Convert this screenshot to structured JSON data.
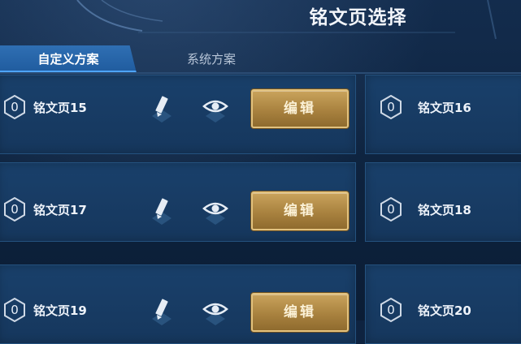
{
  "header": {
    "title": "铭文页选择"
  },
  "tabs": [
    {
      "label": "自定义方案",
      "active": true
    },
    {
      "label": "系统方案",
      "active": false
    }
  ],
  "rows": [
    {
      "left": {
        "count": "0",
        "name": "铭文页15",
        "edit_label": "编辑"
      },
      "right": {
        "count": "0",
        "name": "铭文页16"
      }
    },
    {
      "left": {
        "count": "0",
        "name": "铭文页17",
        "edit_label": "编辑"
      },
      "right": {
        "count": "0",
        "name": "铭文页18"
      }
    },
    {
      "left": {
        "count": "0",
        "name": "铭文页19",
        "edit_label": "编辑"
      },
      "right": {
        "count": "0",
        "name": "铭文页20"
      }
    }
  ],
  "icons": {
    "rename": "pencil-icon",
    "preview": "eye-icon",
    "level": "hexagon-badge-icon"
  },
  "colors": {
    "accent_tab": "#2f6fb3",
    "edit_button": "#b8914a",
    "card_bg": "#183c65"
  }
}
